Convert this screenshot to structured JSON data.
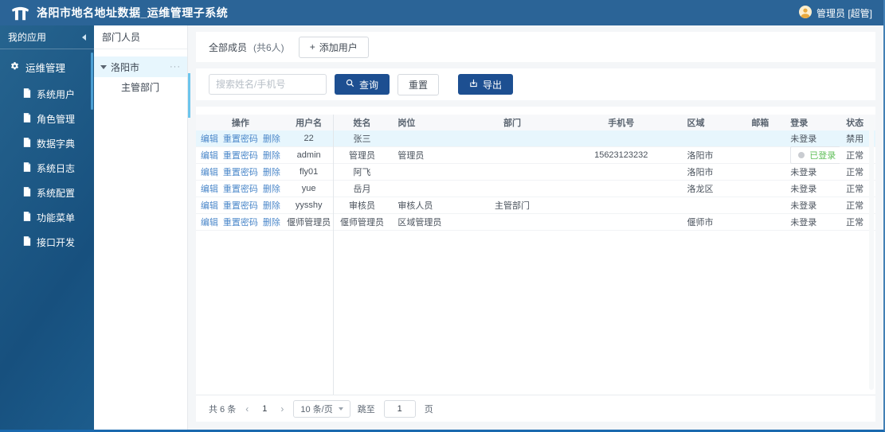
{
  "header": {
    "title": "洛阳市地名地址数据_运维管理子系统",
    "user": "管理员 [超管]"
  },
  "sidebar": {
    "apps_label": "我的应用",
    "group_label": "运维管理",
    "items": [
      {
        "label": "系统用户",
        "icon": "file-icon"
      },
      {
        "label": "角色管理",
        "icon": "file-icon"
      },
      {
        "label": "数据字典",
        "icon": "file-icon"
      },
      {
        "label": "系统日志",
        "icon": "file-icon"
      },
      {
        "label": "系统配置",
        "icon": "file-icon"
      },
      {
        "label": "功能菜单",
        "icon": "file-icon"
      },
      {
        "label": "接口开发",
        "icon": "file-icon"
      }
    ]
  },
  "dept_panel": {
    "title": "部门人员",
    "root_node": "洛阳市",
    "more": "···",
    "child_node": "主管部门"
  },
  "toolbar": {
    "members_label": "全部成员",
    "members_count": "(共6人)",
    "add_user_plus": "+",
    "add_user_label": "添加用户"
  },
  "search": {
    "placeholder": "搜索姓名/手机号",
    "query_label": "查询",
    "reset_label": "重置",
    "export_label": "导出"
  },
  "table": {
    "columns": [
      "操作",
      "用户名",
      "姓名",
      "岗位",
      "部门",
      "手机号",
      "区域",
      "邮箱",
      "登录",
      "状态"
    ],
    "actions": [
      "编辑",
      "重置密码",
      "删除"
    ],
    "rows": [
      {
        "username": "22",
        "name": "张三",
        "position": "",
        "department": "",
        "phone": "",
        "region": "",
        "email": "",
        "login": "未登录",
        "login_type": "text",
        "status": "禁用",
        "highlight": true
      },
      {
        "username": "admin",
        "name": "管理员",
        "position": "管理员",
        "department": "",
        "phone": "15623123232",
        "region": "洛阳市",
        "email": "",
        "login": "已登录",
        "login_type": "tag",
        "status": "正常",
        "highlight": false
      },
      {
        "username": "fly01",
        "name": "阿飞",
        "position": "",
        "department": "",
        "phone": "",
        "region": "洛阳市",
        "email": "",
        "login": "未登录",
        "login_type": "text",
        "status": "正常",
        "highlight": false
      },
      {
        "username": "yue",
        "name": "岳月",
        "position": "",
        "department": "",
        "phone": "",
        "region": "洛龙区",
        "email": "",
        "login": "未登录",
        "login_type": "text",
        "status": "正常",
        "highlight": false
      },
      {
        "username": "yysshy",
        "name": "审核员",
        "position": "审核人员",
        "department": "主管部门",
        "phone": "",
        "region": "",
        "email": "",
        "login": "未登录",
        "login_type": "text",
        "status": "正常",
        "highlight": false
      },
      {
        "username": "偃师管理员",
        "name": "偃师管理员",
        "position": "区域管理员",
        "department": "",
        "phone": "",
        "region": "偃师市",
        "email": "",
        "login": "未登录",
        "login_type": "text",
        "status": "正常",
        "highlight": false
      }
    ]
  },
  "pagination": {
    "total": "共 6 条",
    "prev": "‹",
    "current_page": "1",
    "next": "›",
    "page_size": "10 条/页",
    "jump_label": "跳至",
    "jump_value": "1",
    "page_unit": "页"
  },
  "colors": {
    "header_bg": "#2b6497",
    "primary": "#1d4f91",
    "link": "#4c88ca",
    "selected_row": "#e7f6fd",
    "login_green": "#5fbf59"
  }
}
